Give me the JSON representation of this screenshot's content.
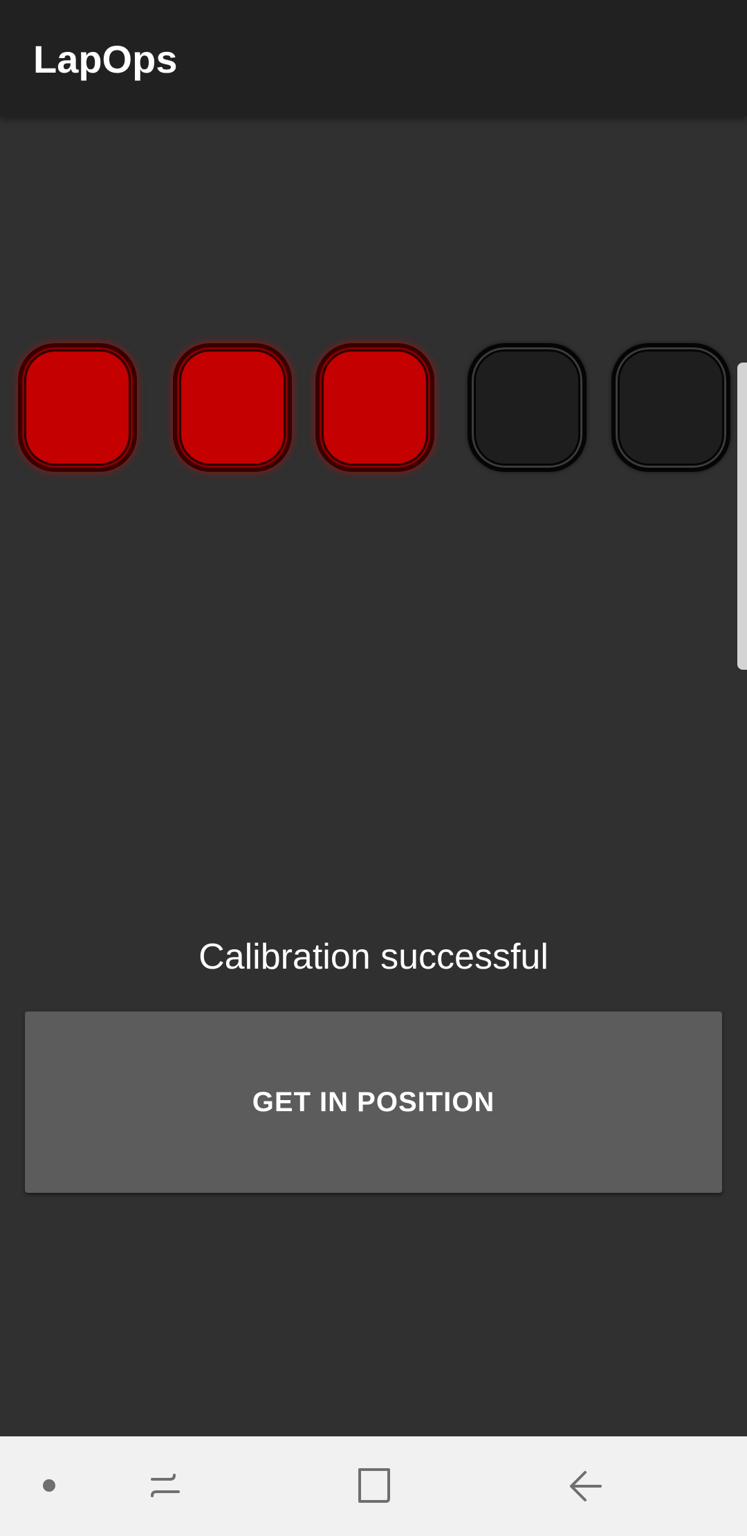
{
  "app_bar": {
    "title": "LapOps"
  },
  "lights": [
    {
      "state": "on",
      "color": "#c40000"
    },
    {
      "state": "on",
      "color": "#c40000"
    },
    {
      "state": "on",
      "color": "#c40000"
    },
    {
      "state": "off",
      "color": "#1e1e1e"
    },
    {
      "state": "off",
      "color": "#1e1e1e"
    }
  ],
  "status": {
    "text": "Calibration successful"
  },
  "action_button": {
    "label": "GET IN POSITION",
    "color": "#5c5c5d"
  },
  "nav_bar": {
    "icons": [
      "dot-icon",
      "recent-apps-icon",
      "home-icon",
      "back-icon"
    ]
  },
  "colors": {
    "background": "#303030",
    "app_bar": "#212121",
    "light_on": "#c40000",
    "light_off": "#1e1e1e",
    "nav_bar": "#f1f1f1"
  }
}
